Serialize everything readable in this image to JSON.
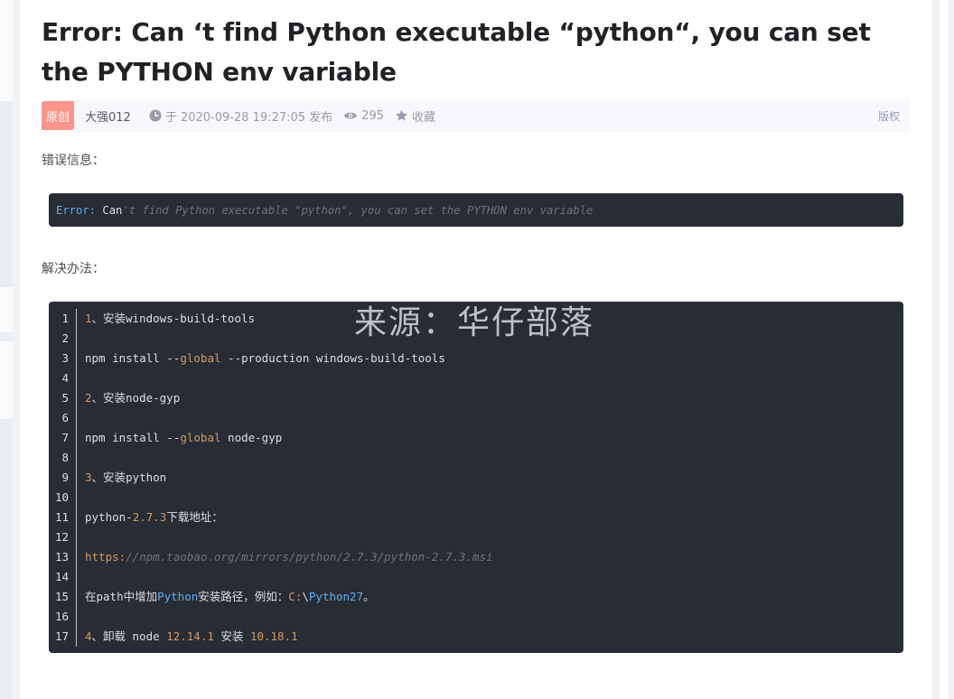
{
  "article": {
    "title": "Error: Can ‘t find Python executable “python“, you can set the PYTHON env variable",
    "badge": "原创",
    "author": "大强012",
    "publish": "于 2020-09-28 19:27:05 发布",
    "views": "295",
    "favorite": "收藏",
    "copyright": "版权"
  },
  "content": {
    "error_heading": "错误信息：",
    "error_code": {
      "keyword": "Error:",
      "plain": " Can",
      "rest": "'t find Python executable \"python\", you can set the PYTHON env variable"
    },
    "solution_heading": "解决办法："
  },
  "code_block": {
    "line_numbers": [
      "1",
      "2",
      "3",
      "4",
      "5",
      "6",
      "7",
      "8",
      "9",
      "10",
      "11",
      "12",
      "13",
      "14",
      "15",
      "16",
      "17"
    ],
    "lines": {
      "l1_num": "1",
      "l1_text": "、安装windows-build-tools",
      "l3_a": "npm install --",
      "l3_kw": "global",
      "l3_b": " --production windows-build-tools",
      "l5_num": "2",
      "l5_text": "、安装node-gyp",
      "l7_a": "npm install --",
      "l7_kw": "global",
      "l7_b": " node-gyp",
      "l9_num": "3",
      "l9_text": "、安装python",
      "l11_a": "python-",
      "l11_num": "2.7.3",
      "l11_b": "下载地址：",
      "l13_kw": "https:",
      "l13_rest": "//npm.taobao.org/mirrors/python/2.7.3/python-2.7.3.msi",
      "l15_a": "在path中增加",
      "l15_bi": "Python",
      "l15_b": "安装路径，例如：",
      "l15_kw": "C:",
      "l15_c": "\\",
      "l15_bi2": "Python27",
      "l15_d": "。",
      "l17_num": "4",
      "l17_a": "、卸载 node ",
      "l17_v1": "12.14.1",
      "l17_b": " 安装 ",
      "l17_v2": "10.18.1"
    }
  },
  "watermark": "来源：华仔部落",
  "colors": {
    "code_bg": "#282c34",
    "badge_bg": "#fc8a7e",
    "keyword_orange": "#d19a66",
    "builtin_blue": "#61aeee"
  }
}
